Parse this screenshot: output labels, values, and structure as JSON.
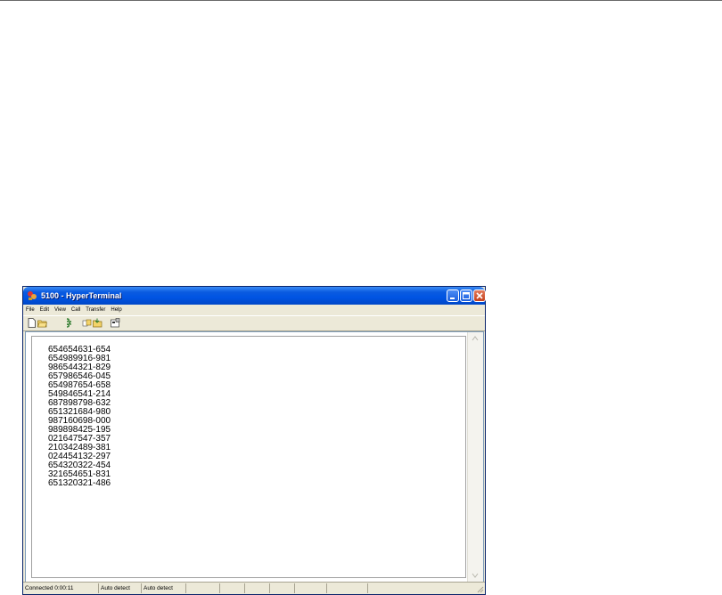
{
  "window": {
    "title": "5100 - HyperTerminal"
  },
  "menu": {
    "items": [
      "File",
      "Edit",
      "View",
      "Call",
      "Transfer",
      "Help"
    ]
  },
  "toolbar": {
    "icons": [
      "new-icon",
      "open-icon",
      "disconnect-icon",
      "send-icon",
      "receive-icon",
      "properties-icon"
    ]
  },
  "terminal": {
    "lines": [
      "654654631-654",
      "654989916-981",
      "986544321-829",
      "657986546-045",
      "654987654-658",
      "549846541-214",
      "687898798-632",
      "651321684-980",
      "987160698-000",
      "989898425-195",
      "021647547-357",
      "210342489-381",
      "024454132-297",
      "654320322-454",
      "321654651-831",
      "651320321-486"
    ]
  },
  "status": {
    "connected": "Connected 0:00:11",
    "detect1": "Auto detect",
    "detect2": "Auto detect"
  },
  "colors": {
    "titlebar": "#0054e3",
    "chrome": "#ece9d8",
    "close_button": "#c4401c"
  }
}
